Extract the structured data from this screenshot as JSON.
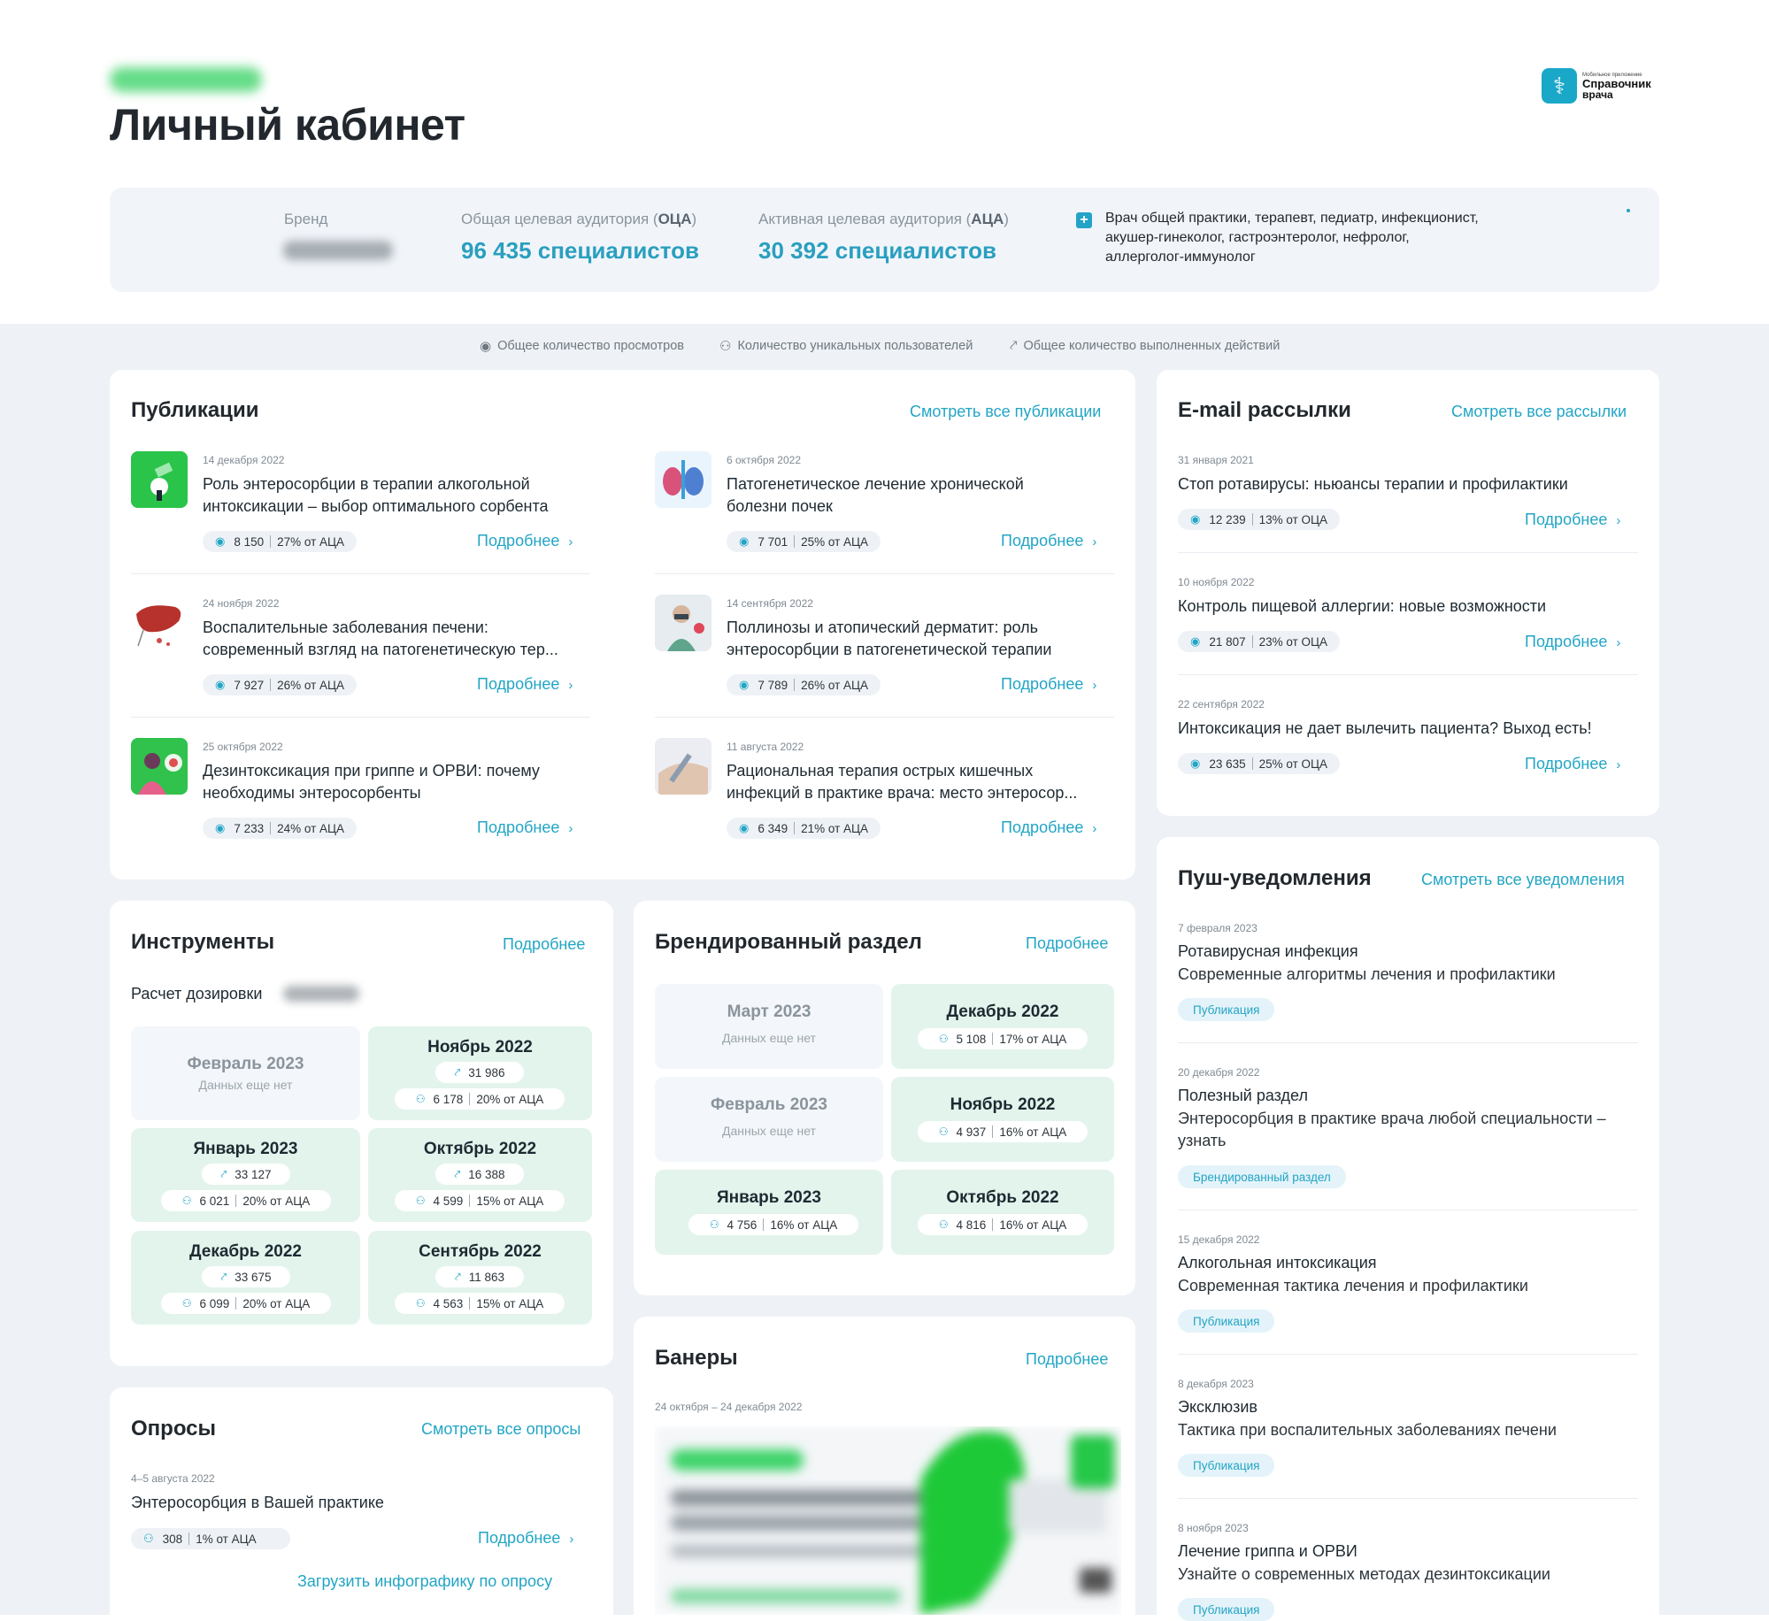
{
  "header": {
    "title": "Личный кабинет",
    "logo": {
      "small": "Мобильное приложение",
      "name": "Справочник",
      "sub": "врача"
    }
  },
  "info": {
    "brand_label": "Бренд",
    "oca_label": "Общая целевая аудитория (",
    "oca_abbr": "ОЦА",
    "oca_close": ")",
    "oca_value": "96 435 специалистов",
    "aca_label": "Активная целевая аудитория (",
    "aca_abbr": "АЦА",
    "aca_close": ")",
    "aca_value": "30 392 специалистов",
    "specialties": "Врач общей практики, терапевт, педиатр, инфекционист, акушер-гинеколог, гастроэнтеролог, нефролог, аллерголог-иммунолог"
  },
  "legend": {
    "views": "Общее количество просмотров",
    "users": "Количество уникальных пользователей",
    "actions": "Общее количество выполненных действий"
  },
  "publications": {
    "title": "Публикации",
    "link": "Смотреть все публикации",
    "more_label": "Подробнее",
    "items": [
      {
        "date": "14 декабря 2022",
        "title1": "Роль энтеросорбции в терапии алкогольной",
        "title2": "интоксикации – выбор оптимального сорбента",
        "views": "8 150",
        "share": "27% от АЦА"
      },
      {
        "date": "6 октября 2022",
        "title1": "Патогенетическое лечение хронической",
        "title2": "болезни почек",
        "views": "7 701",
        "share": "25% от АЦА"
      },
      {
        "date": "24 ноября 2022",
        "title1": "Воспалительные заболевания печени:",
        "title2": "современный взгляд на патогенетическую тер...",
        "views": "7 927",
        "share": "26% от АЦА"
      },
      {
        "date": "14 сентября 2022",
        "title1": "Поллинозы и атопический дерматит: роль",
        "title2": "энтеросорбции в патогенетической терапии",
        "views": "7 789",
        "share": "26% от АЦА"
      },
      {
        "date": "25 октября 2022",
        "title1": "Дезинтоксикация при гриппе и ОРВИ: почему",
        "title2": "необходимы энтеросорбенты",
        "views": "7 233",
        "share": "24% от АЦА"
      },
      {
        "date": "11 августа 2022",
        "title1": "Рациональная терапия острых кишечных",
        "title2": "инфекций в практике врача: место энтеросор...",
        "views": "6 349",
        "share": "21% от АЦА"
      }
    ]
  },
  "email": {
    "title": "E-mail рассылки",
    "link": "Смотреть все рассылки",
    "more_label": "Подробнее",
    "items": [
      {
        "date": "31 января 2021",
        "title": "Стоп ротавирусы: ньюансы терапии и профилактики",
        "views": "12 239",
        "share": "13% от ОЦА"
      },
      {
        "date": "10 ноября 2022",
        "title": "Контроль пищевой аллергии: новые возможности",
        "views": "21 807",
        "share": "23% от ОЦА"
      },
      {
        "date": "22 сентября 2022",
        "title": "Интоксикация не дает вылечить пациента? Выход есть!",
        "views": "23 635",
        "share": "25% от ОЦА"
      }
    ]
  },
  "tools": {
    "title": "Инструменты",
    "link": "Подробнее",
    "subtitle": "Расчет дозировки",
    "nodata": "Данных еще нет",
    "tiles": [
      {
        "month": "Февраль 2023",
        "empty": true
      },
      {
        "month": "Ноябрь 2022",
        "actions": "31 986",
        "users": "6 178",
        "share": "20% от АЦА"
      },
      {
        "month": "Январь 2023",
        "actions": "33 127",
        "users": "6 021",
        "share": "20% от АЦА"
      },
      {
        "month": "Октябрь 2022",
        "actions": "16 388",
        "users": "4 599",
        "share": "15% от АЦА"
      },
      {
        "month": "Декабрь 2022",
        "actions": "33 675",
        "users": "6 099",
        "share": "20% от АЦА"
      },
      {
        "month": "Сентябрь 2022",
        "actions": "11 863",
        "users": "4 563",
        "share": "15% от АЦА"
      }
    ]
  },
  "branded": {
    "title": "Брендированный раздел",
    "link": "Подробнее",
    "nodata": "Данных еще нет",
    "tiles": [
      {
        "month": "Март 2023",
        "empty": true
      },
      {
        "month": "Декабрь 2022",
        "users": "5 108",
        "share": "17% от АЦА"
      },
      {
        "month": "Февраль 2023",
        "empty": true
      },
      {
        "month": "Ноябрь 2022",
        "users": "4 937",
        "share": "16% от АЦА"
      },
      {
        "month": "Январь 2023",
        "users": "4 756",
        "share": "16% от АЦА"
      },
      {
        "month": "Октябрь 2022",
        "users": "4 816",
        "share": "16% от АЦА"
      }
    ]
  },
  "push": {
    "title": "Пуш-уведомления",
    "link": "Смотреть все уведомления",
    "items": [
      {
        "date": "7 февраля 2023",
        "title": "Ротавирусная инфекция",
        "sub1": "Современные алгоритмы лечения и профилактики",
        "sub2": "",
        "badge": "Публикация"
      },
      {
        "date": "20 декабря 2022",
        "title": "Полезный раздел",
        "sub1": "Энтеросорбция в практике врача любой специальности –",
        "sub2": "узнать",
        "badge": "Брендированный раздел"
      },
      {
        "date": "15 декабря 2022",
        "title": "Алкогольная интоксикация",
        "sub1": "Современная тактика лечения и профилактики",
        "sub2": "",
        "badge": "Публикация"
      },
      {
        "date": "8 декабря 2023",
        "title": "Эксклюзив",
        "sub1": "Тактика при воспалительных заболеваниях печени",
        "sub2": "",
        "badge": "Публикация"
      },
      {
        "date": "8 ноября 2023",
        "title": "Лечение гриппа и ОРВИ",
        "sub1": "Узнайте о современных методах дезинтоксикации",
        "sub2": "",
        "badge": "Публикация"
      }
    ]
  },
  "surveys": {
    "title": "Опросы",
    "link": "Смотреть все опросы",
    "date": "4–5 августа 2022",
    "item_title": "Энтеросорбция в Вашей практике",
    "users": "308",
    "share": "1% от АЦА",
    "more_label": "Подробнее",
    "download": "Загрузить инфографику по опросу"
  },
  "banners": {
    "title": "Банеры",
    "link": "Подробнее",
    "period": "24 октября – 24 декабря 2022"
  },
  "colors": {
    "accent": "#22a5c5",
    "tile_green": "#e3f4ec",
    "tile_empty": "#f3f6fa",
    "page_gray": "#eef1f5"
  }
}
